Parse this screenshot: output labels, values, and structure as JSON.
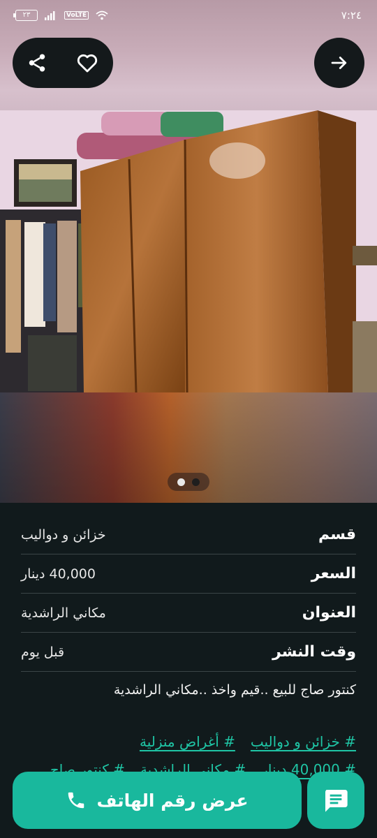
{
  "status_bar": {
    "time": "٧:٢٤",
    "battery": "٢٣",
    "network_badge": "VoLTE"
  },
  "listing": {
    "image_index": 0,
    "image_count": 2,
    "details": [
      {
        "label": "قسم",
        "value": "خزائن و دواليب"
      },
      {
        "label": "السعر",
        "value": "40,000 دينار"
      },
      {
        "label": "العنوان",
        "value": "مكاني الراشدية"
      },
      {
        "label": "وقت النشر",
        "value": "قبل يوم"
      }
    ],
    "description": "كنتور صاج للبيع ..قيم واخذ ..مكاني الراشدية",
    "tags_row1": [
      "# خزائن و دواليب",
      "# أغراض منزلية"
    ],
    "tags_row2": [
      "# 40,000 دينار",
      "# مكاني الراشدية",
      "# كنتور صاج"
    ]
  },
  "actions": {
    "show_phone_label": "عرض رقم الهاتف"
  },
  "icons": {
    "back": "arrow-right-icon",
    "favorite": "heart-icon",
    "share": "share-icon",
    "phone": "phone-icon",
    "chat": "chat-icon"
  },
  "colors": {
    "accent": "#19b89d",
    "tag": "#1fc5a5",
    "background": "#111a1c"
  }
}
